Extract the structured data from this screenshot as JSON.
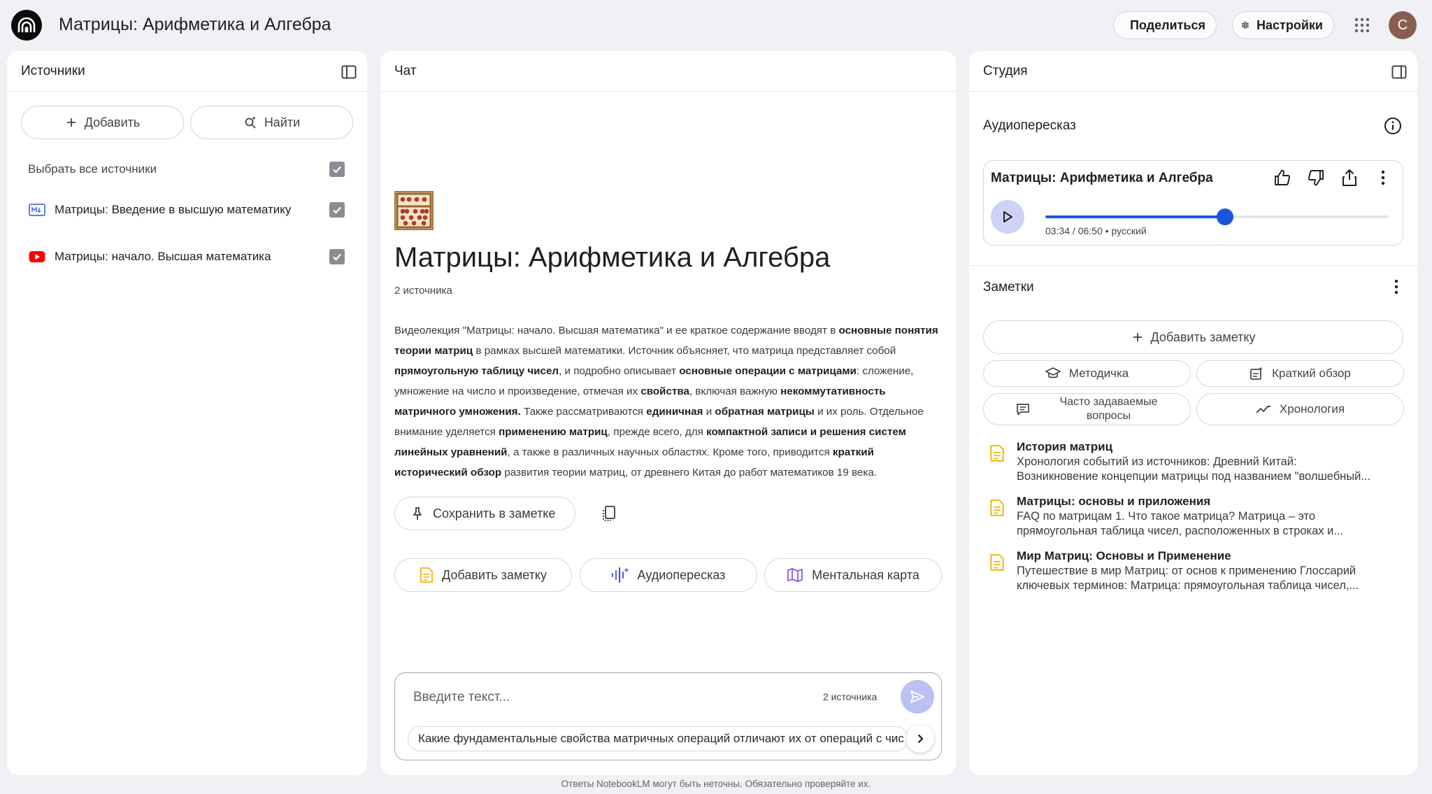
{
  "header": {
    "title": "Матрицы: Арифметика и Алгебра",
    "share_label": "Поделиться",
    "settings_label": "Настройки",
    "avatar_letter": "C"
  },
  "sources": {
    "title": "Источники",
    "add_label": "Добавить",
    "find_label": "Найти",
    "select_all_label": "Выбрать все источники",
    "items": [
      {
        "title": "Матрицы: Введение в высшую математику",
        "type": "document-icon"
      },
      {
        "title": "Матрицы: начало. Высшая математика",
        "type": "youtube-icon"
      }
    ]
  },
  "chat": {
    "title": "Чат",
    "doc_title": "Матрицы: Арифметика и Алгебра",
    "source_count": "2 источника",
    "summary": [
      {
        "t": "Видеолекция \"Матрицы: начало. Высшая математика\" и ее краткое содержание вводят в ",
        "b": false
      },
      {
        "t": "основные понятия теории матриц",
        "b": true
      },
      {
        "t": " в рамках высшей математики. Источник объясняет, что матрица представляет собой ",
        "b": false
      },
      {
        "t": "прямоугольную таблицу чисел",
        "b": true
      },
      {
        "t": ", и подробно описывает ",
        "b": false
      },
      {
        "t": "основные операции с матрицами",
        "b": true
      },
      {
        "t": ": сложение, умножение на число и произведение, отмечая их ",
        "b": false
      },
      {
        "t": "свойства",
        "b": true
      },
      {
        "t": ", включая важную ",
        "b": false
      },
      {
        "t": "некоммутативность матричного умножения.",
        "b": true
      },
      {
        "t": " Также рассматриваются ",
        "b": false
      },
      {
        "t": "единичная",
        "b": true
      },
      {
        "t": " и ",
        "b": false
      },
      {
        "t": "обратная матрицы",
        "b": true
      },
      {
        "t": " и их роль. Отдельное внимание уделяется ",
        "b": false
      },
      {
        "t": "применению матриц",
        "b": true
      },
      {
        "t": ", прежде всего, для ",
        "b": false
      },
      {
        "t": "компактной записи и решения систем линейных уравнений",
        "b": true
      },
      {
        "t": ", а также в различных научных областях. Кроме того, приводится ",
        "b": false
      },
      {
        "t": "краткий исторический обзор",
        "b": true
      },
      {
        "t": " развития теории матриц, от древнего Китая до работ математиков 19 века.",
        "b": false
      }
    ],
    "save_note_label": "Сохранить в заметке",
    "add_note_label": "Добавить заметку",
    "audio_label": "Аудиопересказ",
    "mindmap_label": "Ментальная карта",
    "input_placeholder": "Введите текст...",
    "input_source_count": "2 источника",
    "suggestion": "Какие фундаментальные свойства матричных операций отличают их от операций с чис"
  },
  "studio": {
    "title": "Студия",
    "audio_section_title": "Аудиопересказ",
    "audio_title": "Матрицы: Арифметика и Алгебра",
    "audio_time": "03:34 / 06:50",
    "audio_lang": "русский",
    "audio_progress": 0.523,
    "notes_title": "Заметки",
    "add_note_label": "Добавить заметку",
    "buttons": {
      "guide": "Методичка",
      "overview": "Краткий обзор",
      "faq_line1": "Часто задаваемые",
      "faq_line2": "вопросы",
      "timeline": "Хронология"
    },
    "notes": [
      {
        "title": "История матриц",
        "line1": "Хронология событий из источников: Древний Китай:",
        "line2": "Возникновение концепции матрицы под названием \"волшебный..."
      },
      {
        "title": "Матрицы: основы и приложения",
        "line1": "FAQ по матрицам 1. Что такое матрица? Матрица – это",
        "line2": "прямоугольная таблица чисел, расположенных в строках и..."
      },
      {
        "title": "Мир Матриц: Основы и Применение",
        "line1": "Путешествие в мир Матриц: от основ к применению Глоссарий",
        "line2": "ключевых терминов: Матрица: прямоугольная таблица чисел,..."
      }
    ]
  },
  "footer": {
    "disclaimer": "Ответы NotebookLM могут быть неточны. Обязательно проверяйте их."
  },
  "colors": {
    "accent": "#1a56db",
    "background": "#eff1f5",
    "note_icon": "#f4b400",
    "youtube": "#ff0000"
  }
}
